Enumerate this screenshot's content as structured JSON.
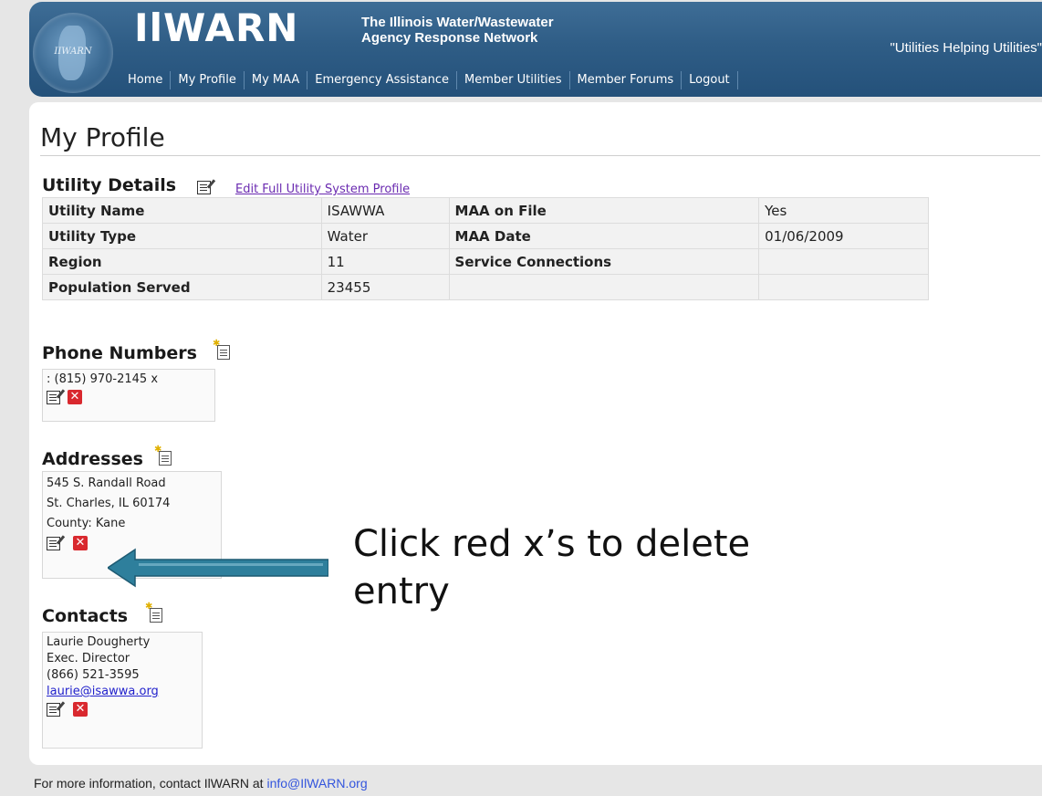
{
  "header": {
    "logo_text": "IIWARN",
    "brand": "IlWARN",
    "tagline_line1": "The Illinois Water/Wastewater",
    "tagline_line2": "Agency Response Network",
    "motto": "\"Utilities Helping Utilities\"",
    "nav": [
      "Home",
      "My Profile",
      "My MAA",
      "Emergency Assistance",
      "Member Utilities",
      "Member Forums",
      "Logout"
    ]
  },
  "page": {
    "title": "My Profile"
  },
  "utility": {
    "heading": "Utility Details",
    "edit_link": "Edit Full Utility System Profile",
    "rows": [
      {
        "label1": "Utility Name",
        "value1": "ISAWWA",
        "label2": "MAA on File",
        "value2": "Yes"
      },
      {
        "label1": "Utility Type",
        "value1": "Water",
        "label2": "MAA Date",
        "value2": "01/06/2009"
      },
      {
        "label1": "Region",
        "value1": "11",
        "label2": "Service Connections",
        "value2": ""
      },
      {
        "label1": "Population Served",
        "value1": "23455",
        "label2": "",
        "value2": ""
      }
    ]
  },
  "phones": {
    "heading": "Phone Numbers",
    "entry": ": (815) 970-2145 x"
  },
  "addresses": {
    "heading": "Addresses",
    "line1": "545 S. Randall Road",
    "line2": "St. Charles, IL 60174",
    "line3": "County: Kane"
  },
  "contacts": {
    "heading": "Contacts",
    "name": "Laurie  Dougherty",
    "title": "Exec. Director",
    "phone": "(866) 521-3595",
    "email": "laurie@isawwa.org"
  },
  "annotation": {
    "line1": "Click red x’s to delete",
    "line2": "entry"
  },
  "footer": {
    "text": "For more information, contact IlWARN at ",
    "email": "info@IlWARN.org"
  },
  "icons": {
    "delete_glyph": "✕"
  },
  "colors": {
    "header_blue": "#2f5d86",
    "delete_red": "#d9282e",
    "arrow_teal": "#2e7f9c",
    "link_purple": "#6a2ab0"
  }
}
